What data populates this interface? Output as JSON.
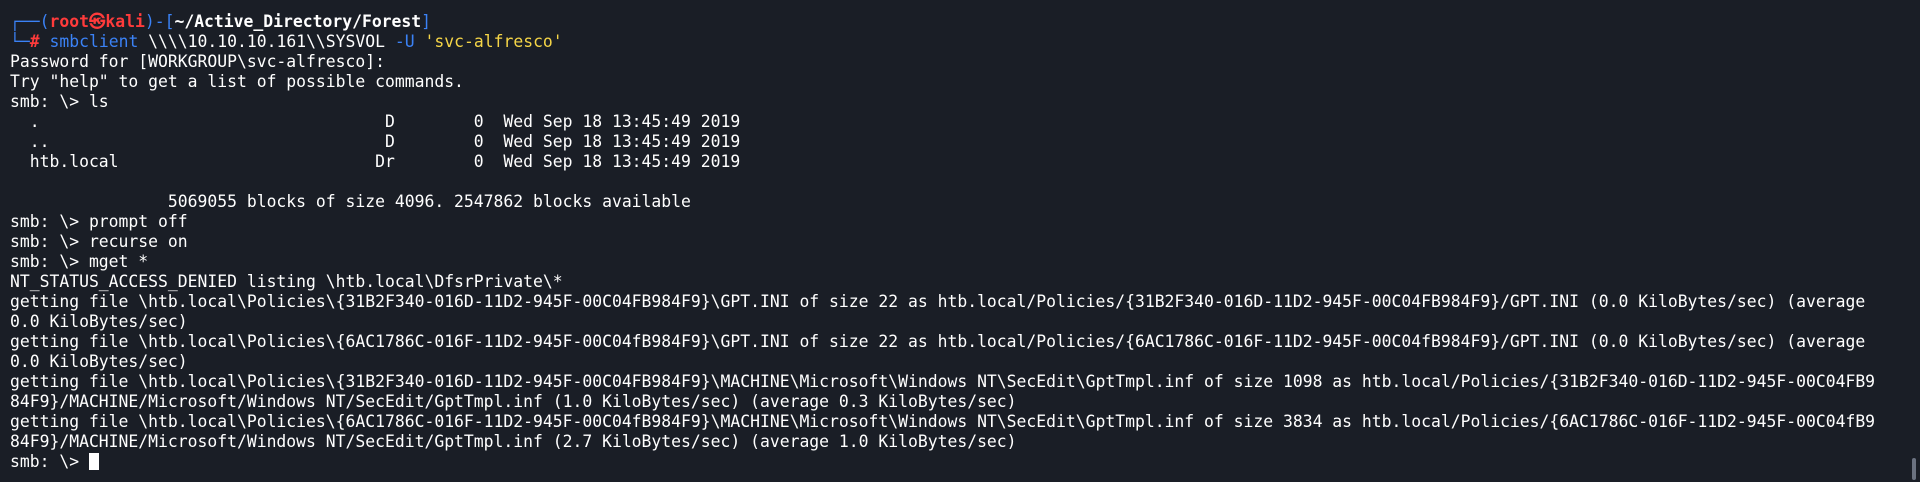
{
  "prompt": {
    "corner_top": "┌──(",
    "user": "root",
    "at": "㉿",
    "host": "kali",
    "sep": ")-[",
    "cwd": "~/Active_Directory/Forest",
    "close": "]",
    "corner_bottom": "└─",
    "hash": "#"
  },
  "command": {
    "program": "smbclient",
    "share": " \\\\\\\\10.10.10.161\\\\SYSVOL ",
    "flag": "-U",
    "user_arg": "'svc-alfresco'"
  },
  "output": {
    "lines": [
      "Password for [WORKGROUP\\svc-alfresco]:",
      "Try \"help\" to get a list of possible commands.",
      "smb: \\> ls",
      "  .                                   D        0  Wed Sep 18 13:45:49 2019",
      "  ..                                  D        0  Wed Sep 18 13:45:49 2019",
      "  htb.local                          Dr        0  Wed Sep 18 13:45:49 2019",
      "",
      "                5069055 blocks of size 4096. 2547862 blocks available",
      "smb: \\> prompt off",
      "smb: \\> recurse on",
      "smb: \\> mget *",
      "NT_STATUS_ACCESS_DENIED listing \\htb.local\\DfsrPrivate\\*",
      "getting file \\htb.local\\Policies\\{31B2F340-016D-11D2-945F-00C04FB984F9}\\GPT.INI of size 22 as htb.local/Policies/{31B2F340-016D-11D2-945F-00C04FB984F9}/GPT.INI (0.0 KiloBytes/sec) (average",
      "0.0 KiloBytes/sec)",
      "getting file \\htb.local\\Policies\\{6AC1786C-016F-11D2-945F-00C04fB984F9}\\GPT.INI of size 22 as htb.local/Policies/{6AC1786C-016F-11D2-945F-00C04fB984F9}/GPT.INI (0.0 KiloBytes/sec) (average",
      "0.0 KiloBytes/sec)",
      "getting file \\htb.local\\Policies\\{31B2F340-016D-11D2-945F-00C04FB984F9}\\MACHINE\\Microsoft\\Windows NT\\SecEdit\\GptTmpl.inf of size 1098 as htb.local/Policies/{31B2F340-016D-11D2-945F-00C04FB9",
      "84F9}/MACHINE/Microsoft/Windows NT/SecEdit/GptTmpl.inf (1.0 KiloBytes/sec) (average 0.3 KiloBytes/sec)",
      "getting file \\htb.local\\Policies\\{6AC1786C-016F-11D2-945F-00C04fB984F9}\\MACHINE\\Microsoft\\Windows NT\\SecEdit\\GptTmpl.inf of size 3834 as htb.local/Policies/{6AC1786C-016F-11D2-945F-00C04fB9",
      "84F9}/MACHINE/Microsoft/Windows NT/SecEdit/GptTmpl.inf (2.7 KiloBytes/sec) (average 1.0 KiloBytes/sec)"
    ],
    "final_prompt": "smb: \\> "
  },
  "colors": {
    "background": "#1a1e26",
    "prompt_frame": "#3b82f6",
    "prompt_user": "#ff3b3b",
    "command": "#3b82f6",
    "string": "#f5d547",
    "text": "#ffffff"
  }
}
